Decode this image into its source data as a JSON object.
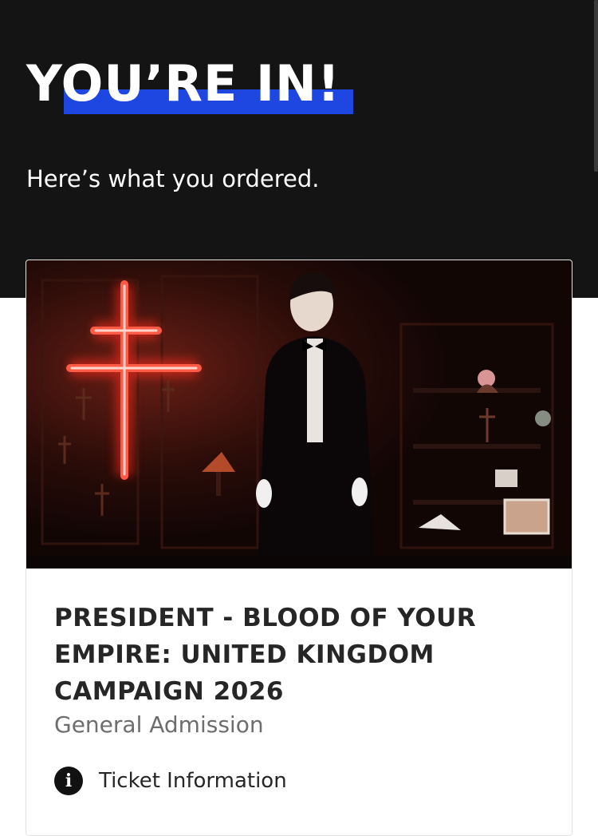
{
  "header": {
    "title": "YOU’RE IN!",
    "subtitle": "Here’s what you ordered."
  },
  "order": {
    "event_title": "PRESIDENT - BLOOD OF YOUR EMPIRE: UNITED KINGDOM CAMPAIGN 2026",
    "ticket_type": "General Admission",
    "ticket_info_label": "Ticket Information",
    "info_icon": "info-icon"
  },
  "colors": {
    "hero_background": "#141414",
    "title_highlight": "#1e46e0",
    "neon_cross": "#ff3b2e"
  }
}
